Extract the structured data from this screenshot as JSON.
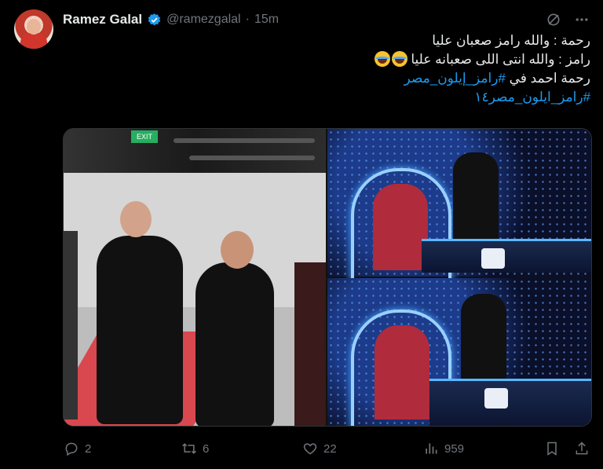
{
  "author": {
    "name": "Ramez Galal",
    "handle": "@ramezgalal",
    "separator": "·",
    "time": "15m",
    "verified": true
  },
  "tweet": {
    "lines": [
      "رحمة : والله رامز صعبان عليا",
      "رامز : والله انتى اللى صعبانه عليا",
      "رحمة احمد في",
      "#رامز_إيلون_مصر",
      "#رامز_ايلون_مصر١٤"
    ],
    "emoji_name": "face-with-tears-of-joy"
  },
  "icons": {
    "grok": "grok-icon",
    "more": "more-icon",
    "verified": "verified-badge-icon",
    "reply": "reply-icon",
    "retweet": "retweet-icon",
    "like": "like-icon",
    "views": "views-icon",
    "bookmark": "bookmark-icon",
    "share": "share-icon"
  },
  "colors": {
    "accent": "#1d9bf0",
    "muted": "#71767b",
    "text": "#e7e9ea",
    "background": "#000000"
  },
  "media": {
    "exit_sign": "EXIT"
  },
  "stats": {
    "replies": "2",
    "retweets": "6",
    "likes": "22",
    "views": "959"
  }
}
